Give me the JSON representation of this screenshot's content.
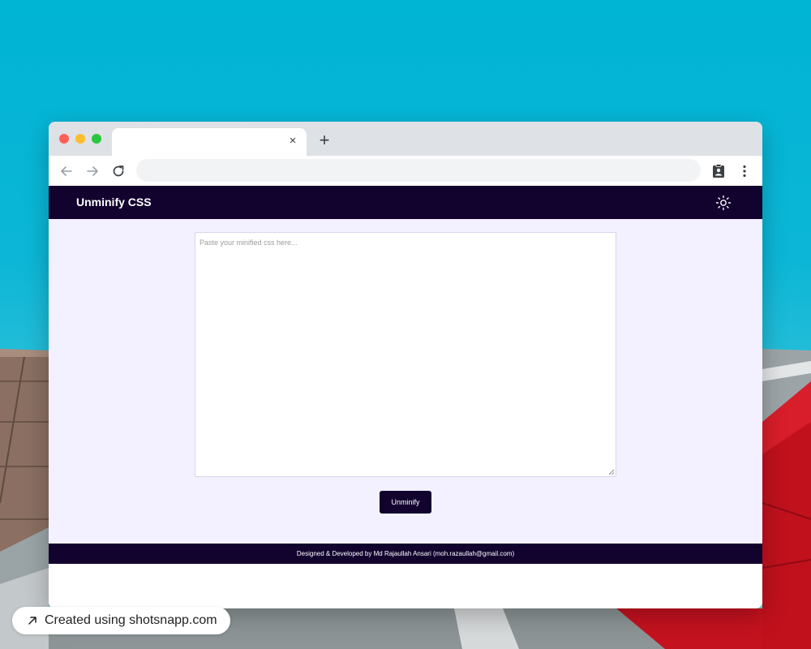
{
  "browser": {
    "tab": {
      "title": "",
      "close_glyph": "×"
    },
    "new_tab_glyph": "+",
    "address_bar": {
      "value": ""
    },
    "icons": [
      "back-arrow-icon",
      "forward-arrow-icon",
      "reload-icon",
      "clipboard-person-icon",
      "kebab-menu-icon",
      "close-icon",
      "plus-icon"
    ]
  },
  "app": {
    "title": "Unminify CSS",
    "theme_toggle_icon": "sun-icon",
    "editor": {
      "placeholder": "Paste your minified css here...",
      "value": ""
    },
    "action_button": "Unminify",
    "footer_text": "Designed & Developed by Md Rajaullah Ansari (moh.razaullah@gmail.com)"
  },
  "credit": {
    "text": "Created using shotsnapp.com",
    "icon": "arrow-up-right-icon"
  },
  "colors": {
    "brand_dark": "#12032e",
    "content_bg": "#f3f0ff",
    "tab_bar": "#dee1e6",
    "address_bar_bg": "#f1f3f4",
    "traffic_red": "#ff5f57",
    "traffic_yellow": "#febc2e",
    "traffic_green": "#28c840"
  }
}
